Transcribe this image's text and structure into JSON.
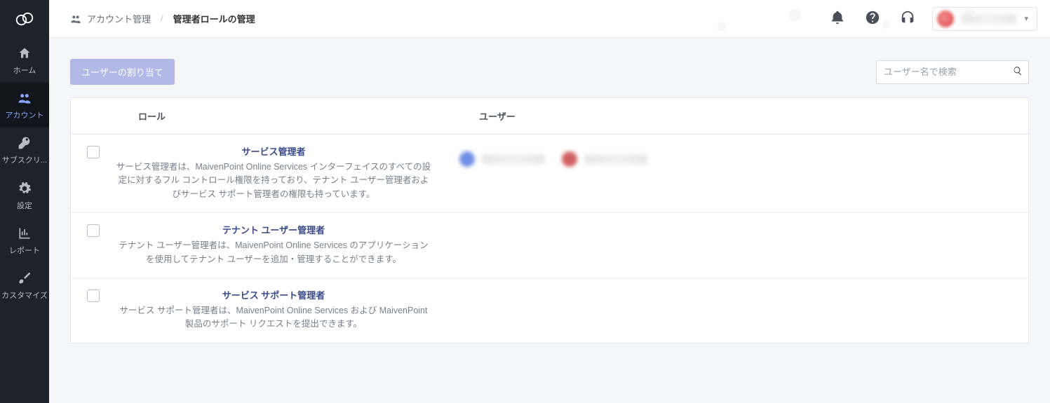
{
  "sidebar": {
    "items": [
      {
        "label": "ホーム"
      },
      {
        "label": "アカウント"
      },
      {
        "label": "サブスクリ..."
      },
      {
        "label": "設定"
      },
      {
        "label": "レポート"
      },
      {
        "label": "カスタマイズ"
      }
    ],
    "active_index": 1
  },
  "breadcrumb": {
    "section": "アカウント管理",
    "current": "管理者ロールの管理"
  },
  "actions": {
    "assign_button": "ユーザーの割り当て"
  },
  "search": {
    "placeholder": "ユーザー名で検索",
    "value": ""
  },
  "table": {
    "headers": {
      "role": "ロール",
      "user": "ユーザー"
    },
    "rows": [
      {
        "title": "サービス管理者",
        "desc": "サービス管理者は、MaivenPoint Online Services インターフェイスのすべての設定に対するフル コントロール権限を持っており、テナント ユーザー管理者およびサービス サポート管理者の権限も持っています。",
        "users": [
          {
            "color": "#6f8fe6"
          },
          {
            "color": "#d06262"
          }
        ]
      },
      {
        "title": "テナント ユーザー管理者",
        "desc": "テナント ユーザー管理者は、MaivenPoint Online Services のアプリケーションを使用してテナント ユーザーを追加・管理することができます。",
        "users": []
      },
      {
        "title": "サービス サポート管理者",
        "desc": "サービス サポート管理者は、MaivenPoint Online Services および MaivenPoint 製品のサポート リクエストを提出できます。",
        "users": []
      }
    ]
  }
}
